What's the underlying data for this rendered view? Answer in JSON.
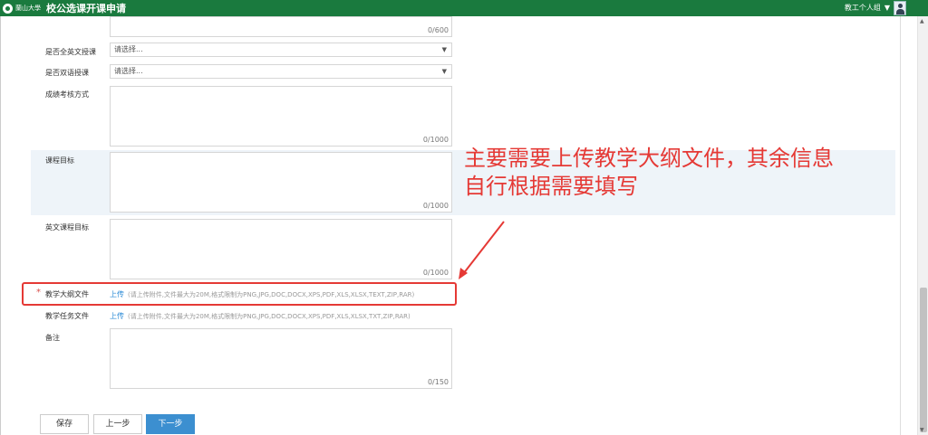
{
  "header": {
    "logo_text": "蘭山大學",
    "title": "校公选课开课申请",
    "user_menu": "教工个人组",
    "colors": {
      "bar": "#1a7a3e"
    }
  },
  "form": {
    "top_counter": "0/600",
    "english_course": {
      "label": "是否全英文授课",
      "value": "请选择..."
    },
    "bilingual_course": {
      "label": "是否双语授课",
      "value": "请选择..."
    },
    "assessment": {
      "label": "成绩考核方式",
      "counter": "0/1000"
    },
    "course_goal": {
      "label": "课程目标",
      "counter": "0/1000"
    },
    "english_goal": {
      "label": "英文课程目标",
      "counter": "0/1000"
    },
    "syllabus": {
      "required_mark": "*",
      "label": "教学大纲文件",
      "upload_label": "上传",
      "hint": "(请上传附件,文件最大为20M,格式限制为PNG,JPG,DOC,DOCX,XPS,PDF,XLS,XLSX,TEXT,ZIP,RAR)"
    },
    "task_doc": {
      "label": "教学任务文件",
      "upload_label": "上传",
      "hint": "(请上传附件,文件最大为20M,格式限制为PNG,JPG,DOC,DOCX,XPS,PDF,XLS,XLSX,TXT,ZIP,RAR)"
    },
    "remarks": {
      "label": "备注",
      "counter": "0/150"
    }
  },
  "annotation": {
    "line1": "主要需要上传教学大纲文件，其余信息",
    "line2": "自行根据需要填写",
    "color": "#e53935"
  },
  "buttons": {
    "save": "保存",
    "prev": "上一步",
    "next": "下一步"
  }
}
